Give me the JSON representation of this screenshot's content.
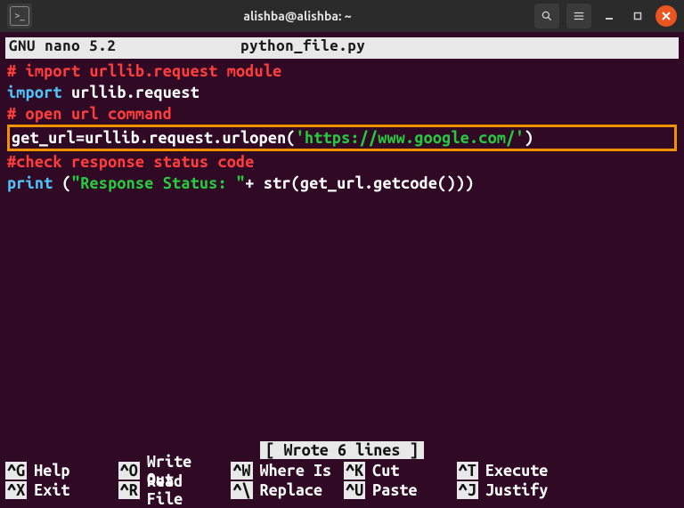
{
  "titlebar": {
    "title": "alishba@alishba: ~"
  },
  "nano": {
    "app": "GNU nano 5.2",
    "filename": "python_file.py",
    "status": "[ Wrote 6 lines ]"
  },
  "code": {
    "l1_comment": "# import urllib.request module",
    "l2_kw": "import",
    "l2_rest": " urllib.request",
    "l3_comment": "# open url command",
    "l4_pre": "get_url=urllib.request.urlopen(",
    "l4_q1": "'",
    "l4_str": "https://www.google.com/",
    "l4_q2": "'",
    "l4_post": ")",
    "l5_comment": "#check response status code",
    "l6_kw": "print",
    "l6_a": " (",
    "l6_str": "\"Response Status: \"",
    "l6_b": "+ ",
    "l6_c": "str(get_url.getcode()))"
  },
  "shortcuts": [
    {
      "key": "^G",
      "label": "Help"
    },
    {
      "key": "^O",
      "label": "Write Out"
    },
    {
      "key": "^W",
      "label": "Where Is"
    },
    {
      "key": "^K",
      "label": "Cut"
    },
    {
      "key": "^T",
      "label": "Execute"
    },
    {
      "key": "^X",
      "label": "Exit"
    },
    {
      "key": "^R",
      "label": "Read File"
    },
    {
      "key": "^\\",
      "label": "Replace"
    },
    {
      "key": "^U",
      "label": "Paste"
    },
    {
      "key": "^J",
      "label": "Justify"
    }
  ]
}
